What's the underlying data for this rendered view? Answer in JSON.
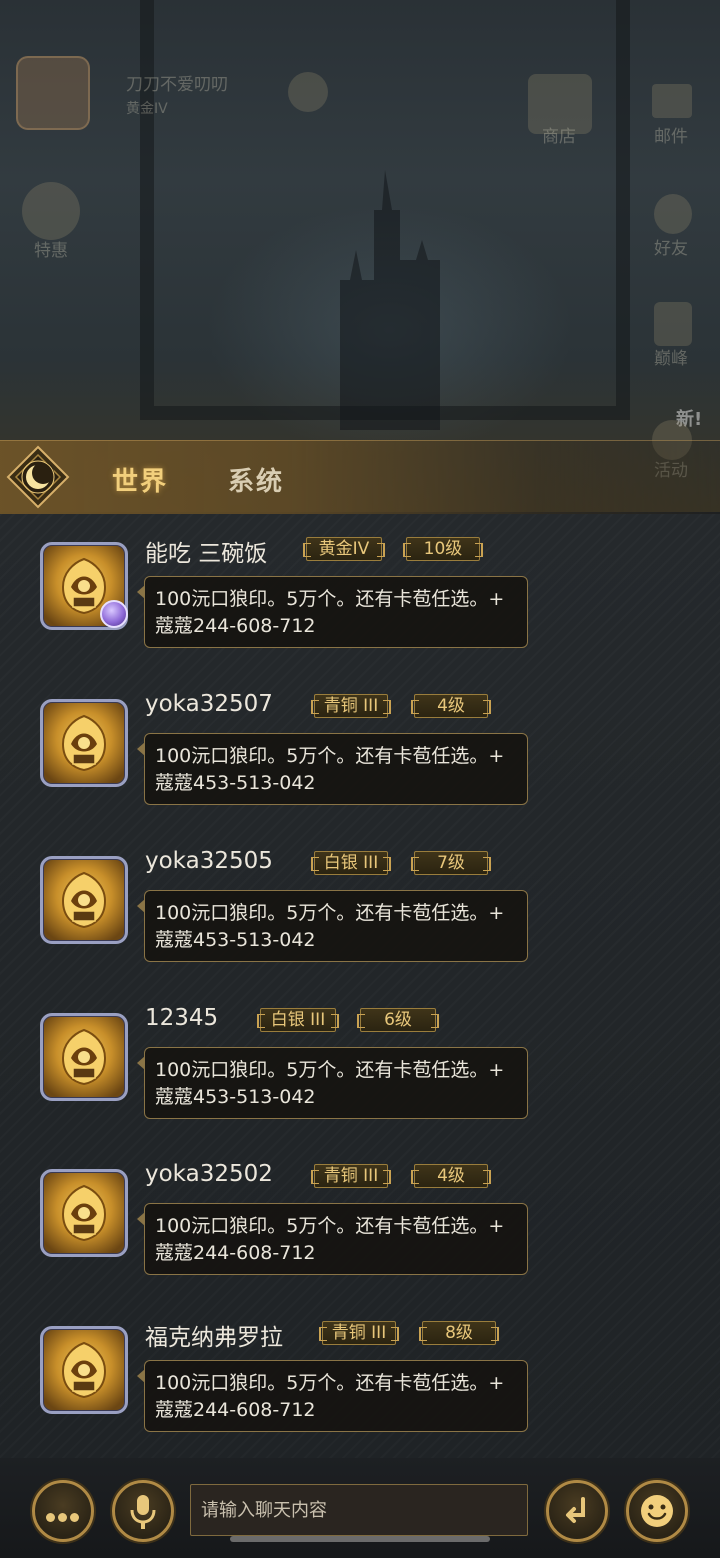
{
  "background": {
    "player_name": "刀刀不爱叨叨",
    "player_rank": "黄金IV",
    "left_icons": [
      "特惠"
    ],
    "right_icons": [
      "商店",
      "邮件",
      "好友",
      "巅峰",
      "活动"
    ],
    "new_badge": "新!"
  },
  "tabs": [
    {
      "label": "世界",
      "active": true
    },
    {
      "label": "系统",
      "active": false
    }
  ],
  "messages": [
    {
      "name": "能吃 三碗饭",
      "rank": "黄金IV",
      "level": "10级",
      "line1": "100沅口狼印。5万个。还有卡苞任选。+",
      "line2": "蔻蔻244-608-712",
      "has_dot": true
    },
    {
      "name": "yoka32507",
      "rank": "青铜 III",
      "level": "4级",
      "line1": "100沅口狼印。5万个。还有卡苞任选。+",
      "line2": "蔻蔻453-513-042",
      "has_dot": false
    },
    {
      "name": "yoka32505",
      "rank": "白银 III",
      "level": "7级",
      "line1": "100沅口狼印。5万个。还有卡苞任选。+",
      "line2": "蔻蔻453-513-042",
      "has_dot": false
    },
    {
      "name": "12345",
      "rank": "白银 III",
      "level": "6级",
      "line1": "100沅口狼印。5万个。还有卡苞任选。+",
      "line2": "蔻蔻453-513-042",
      "has_dot": false
    },
    {
      "name": "yoka32502",
      "rank": "青铜 III",
      "level": "4级",
      "line1": "100沅口狼印。5万个。还有卡苞任选。+",
      "line2": "蔻蔻244-608-712",
      "has_dot": false
    },
    {
      "name": "福克纳弗罗拉",
      "rank": "青铜 III",
      "level": "8级",
      "line1": "100沅口狼印。5万个。还有卡苞任选。+",
      "line2": "蔻蔻244-608-712",
      "has_dot": false
    }
  ],
  "input": {
    "placeholder": "请输入聊天内容",
    "value": ""
  },
  "colors": {
    "accent_gold": "#e8c77b",
    "tab_active": "#f2cf7c",
    "bubble_border": "#8a7446"
  },
  "icons": {
    "more": "more-dots-icon",
    "voice": "microphone-icon",
    "send": "return-arrow-icon",
    "emoji": "smiley-icon"
  }
}
